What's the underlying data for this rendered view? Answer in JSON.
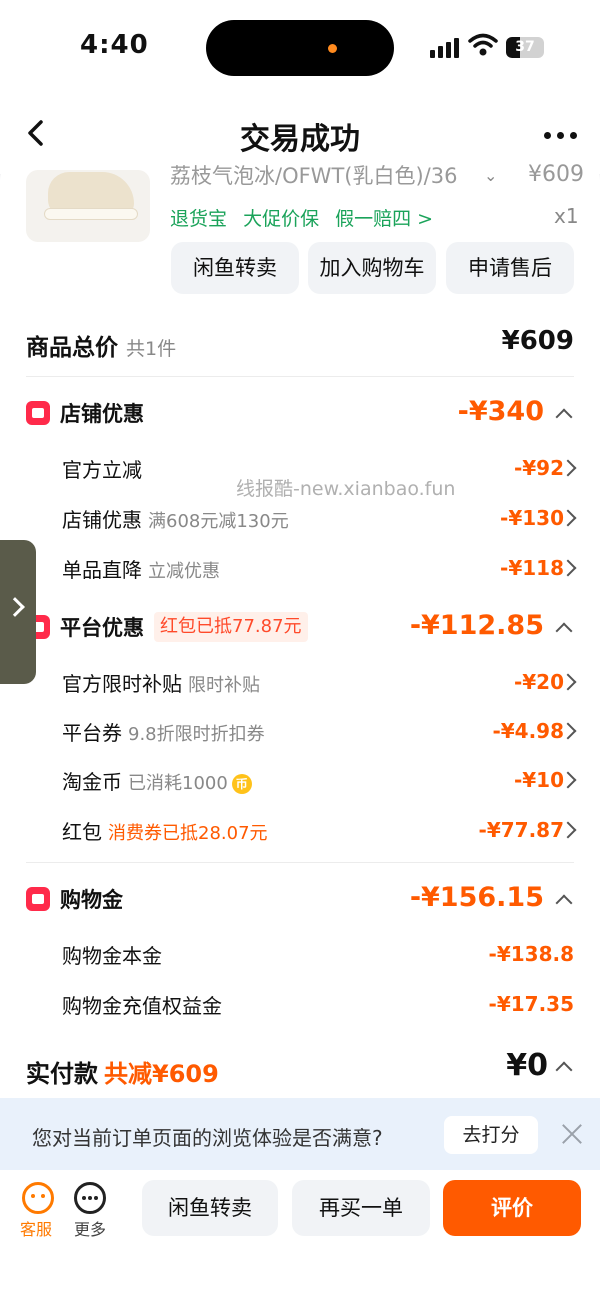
{
  "status_bar": {
    "time": "4:40",
    "battery": "37",
    "battery_level_pct": 37
  },
  "nav": {
    "title": "交易成功"
  },
  "product": {
    "name": "荔枝气泡冰/OFWT(乳白色)/36",
    "price": "¥609",
    "quantity": "x1",
    "service_tags": [
      "退货宝",
      "大促价保",
      "假一赔四 >"
    ],
    "actions": [
      "闲鱼转卖",
      "加入购物车",
      "申请售后"
    ]
  },
  "price_summary": {
    "total_label": "商品总价",
    "total_count": "共1件",
    "total_value": "¥609",
    "store_discount": {
      "label": "店铺优惠",
      "amount": "-¥340",
      "items": [
        {
          "label": "官方立减",
          "note": "",
          "amount": "-¥92"
        },
        {
          "label": "店铺优惠",
          "note": "满608元减130元",
          "amount": "-¥130"
        },
        {
          "label": "单品直降",
          "note": "立减优惠",
          "amount": "-¥118"
        }
      ]
    },
    "platform_discount": {
      "label": "平台优惠",
      "tag": "红包已抵77.87元",
      "amount": "-¥112.85",
      "items": [
        {
          "label": "官方限时补贴",
          "note": "限时补贴",
          "amount": "-¥20"
        },
        {
          "label": "平台券",
          "note": "9.8折限时折扣券",
          "amount": "-¥4.98"
        },
        {
          "label": "淘金币",
          "note": "已消耗1000",
          "amount": "-¥10"
        },
        {
          "label": "红包",
          "note": "消费券已抵28.07元",
          "amount": "-¥77.87"
        }
      ]
    },
    "shopping_gold": {
      "label": "购物金",
      "amount": "-¥156.15",
      "items": [
        {
          "label": "购物金本金",
          "amount": "-¥138.8"
        },
        {
          "label": "购物金充值权益金",
          "amount": "-¥17.35"
        }
      ]
    },
    "paid_label": "实付款",
    "paid_saved": "共减¥609",
    "paid_value": "¥0"
  },
  "watermark": "线报酷-new.xianbao.fun",
  "coin_glyph": "币",
  "survey": {
    "question": "您对当前订单页面的浏览体验是否满意?",
    "button": "去打分"
  },
  "bottom_bar": {
    "service_label": "客服",
    "more_label": "更多",
    "resell_button": "闲鱼转卖",
    "rebuy_button": "再买一单",
    "review_button": "评价"
  },
  "colors": {
    "accent": "#ff5a00",
    "green": "#1ba35a",
    "review_button": "#ff5a00",
    "red_icon": "#ff2a4a"
  }
}
